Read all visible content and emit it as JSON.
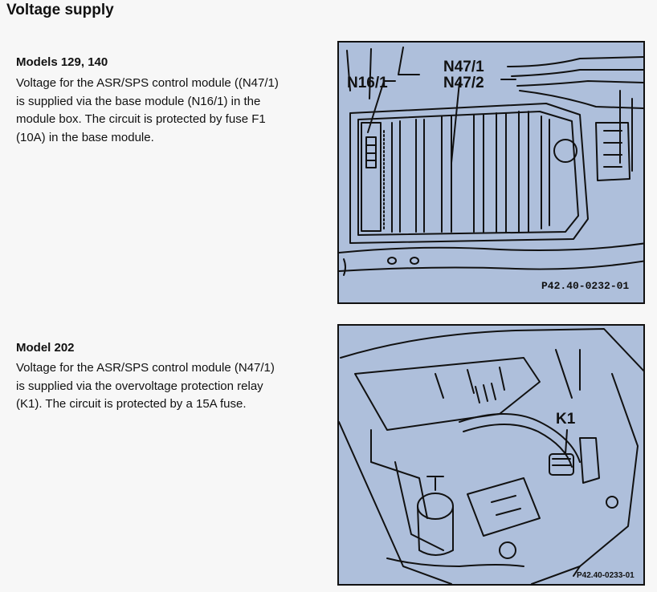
{
  "page": {
    "title": "Voltage supply"
  },
  "sections": [
    {
      "heading": "Models 129, 140",
      "body": "Voltage for the ASR/SPS control module ((N47/1) is supplied via the base module (N16/1) in the module box.  The circuit is protected by fuse F1 (10A) in the base module.",
      "figure": {
        "callouts": [
          "N16/1",
          "N47/1",
          "N47/2"
        ],
        "code": "P42.40-0232-01"
      }
    },
    {
      "heading": "Model 202",
      "body": "Voltage for the ASR/SPS control module (N47/1) is supplied via the overvoltage protection relay (K1).  The circuit is protected by a 15A fuse.",
      "figure": {
        "callouts": [
          "K1"
        ],
        "code": "P42.40-0233-01"
      }
    }
  ],
  "colors": {
    "figure_background": "#aebfdb",
    "line": "#111111",
    "page": "#f7f7f7"
  }
}
